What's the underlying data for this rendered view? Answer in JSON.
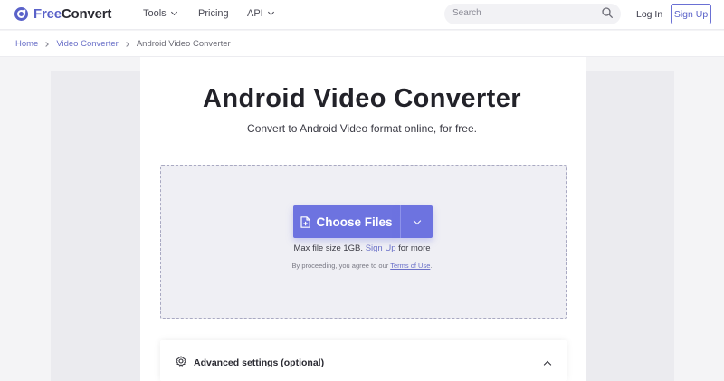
{
  "header": {
    "logo_free": "Free",
    "logo_convert": "Convert",
    "nav": {
      "tools": "Tools",
      "pricing": "Pricing",
      "api": "API"
    },
    "search_placeholder": "Search",
    "login": "Log In",
    "signup": "Sign Up"
  },
  "breadcrumb": {
    "items": [
      "Home",
      "Video Converter",
      "Android Video Converter"
    ]
  },
  "main": {
    "title": "Android Video Converter",
    "subtitle": "Convert to Android Video format online, for free.",
    "choose_files": "Choose Files",
    "max_size_prefix": "Max file size 1GB.",
    "max_size_link": "Sign Up",
    "max_size_suffix": "for more",
    "terms_prefix": "By proceeding, you agree to our",
    "terms_link": "Terms of Use",
    "terms_suffix": ".",
    "advanced_label": "Advanced settings (optional)"
  },
  "colors": {
    "accent": "#6d73e0",
    "brand": "#5a62c9",
    "link": "#6a70c8"
  },
  "icons": [
    "logo-icon",
    "chevron-down-icon",
    "search-icon",
    "file-add-icon",
    "gear-icon",
    "chevron-up-icon"
  ]
}
